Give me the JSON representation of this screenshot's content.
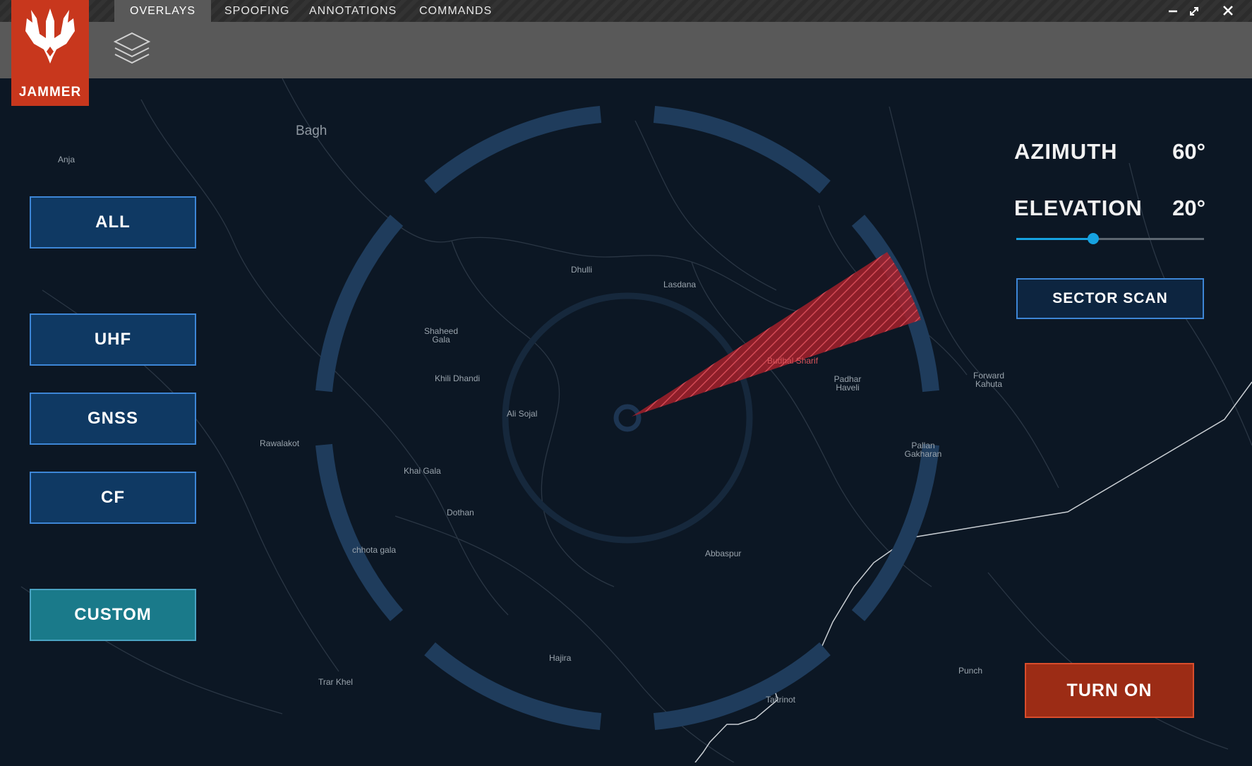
{
  "app": {
    "name": "JAMMER"
  },
  "tabs": [
    {
      "label": "OVERLAYS"
    },
    {
      "label": "SPOOFING"
    },
    {
      "label": "ANNOTATIONS"
    },
    {
      "label": "COMMANDS"
    }
  ],
  "bands": {
    "all": "ALL",
    "uhf": "UHF",
    "gnss": "GNSS",
    "cf": "CF",
    "custom": "CUSTOM"
  },
  "controls": {
    "azimuth_label": "AZIMUTH",
    "azimuth_value": "60°",
    "elevation_label": "ELEVATION",
    "elevation_value": "20°",
    "elevation_slider_fraction": 0.41,
    "sector_scan_label": "SECTOR SCAN",
    "turn_on_label": "TURN ON"
  },
  "map_places": {
    "bagh": "Bagh",
    "anja": "Anja",
    "dhulli": "Dhulli",
    "lasdana": "Lasdana",
    "shaheed_gala": "Shaheed Gala",
    "khili_dhandi": "Khili Dhandi",
    "budhal_sharif": "Budhal Sharif",
    "padhar_haveli": "Padhar Haveli",
    "forward_kahuta": "Forward Kahuta",
    "ali_sojal": "Ali Sojal",
    "rawalakot": "Rawalakot",
    "khai_gala": "Khai Gala",
    "pallan_gakharan": "Pallan Gakharan",
    "dothan": "Dothan",
    "chhota_gala": "chhota gala",
    "abbaspur": "Abbaspur",
    "hajira": "Hajira",
    "trar_khel": "Trar Khel",
    "taitrinot": "Taitrinot",
    "punch": "Punch"
  },
  "colors": {
    "logo": "#c8371d",
    "accent_blue": "#16a2e0",
    "button_blue": "#0f3963",
    "custom_teal": "#1a7a8a",
    "turn_on_red": "#9c2c15",
    "beam_red": "#b3222c"
  },
  "icons": {
    "logo": "trident-logo-icon",
    "layers": "layers-icon",
    "minimize": "minimize-icon",
    "maximize": "maximize-icon",
    "close": "close-icon"
  }
}
